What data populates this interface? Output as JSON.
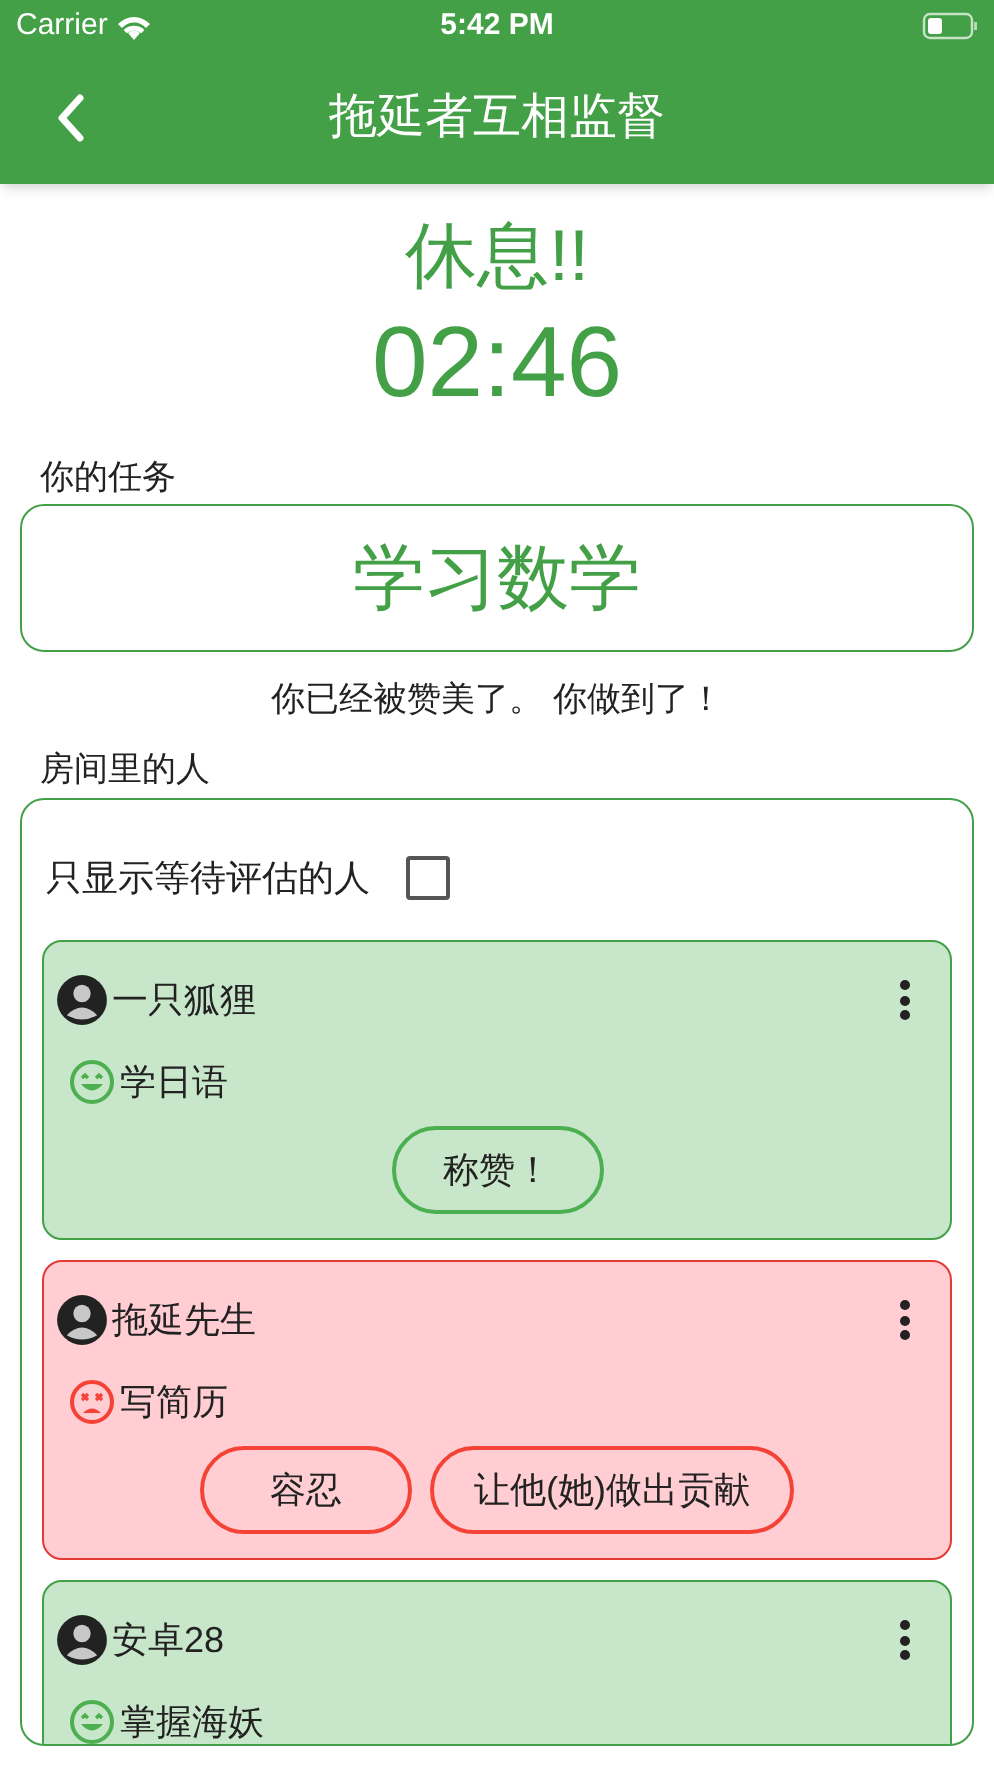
{
  "status_bar": {
    "carrier": "Carrier",
    "time": "5:42 PM"
  },
  "nav": {
    "title": "拖延者互相监督"
  },
  "state_title": "休息!!",
  "timer": "02:46",
  "task": {
    "label": "你的任务",
    "value": "学习数学"
  },
  "message": "你已经被赞美了。 你做到了！",
  "room": {
    "label": "房间里的人",
    "filter": {
      "label": "只显示等待评估的人",
      "checked": false
    },
    "people": [
      {
        "name": "一只狐狸",
        "task": "学日语",
        "kind": "good",
        "buttons": [
          "称赞！"
        ]
      },
      {
        "name": "拖延先生",
        "task": "写简历",
        "kind": "bad",
        "buttons": [
          "容忍",
          "让他(她)做出贡献"
        ]
      },
      {
        "name": "安卓28",
        "task": "掌握海妖",
        "kind": "good"
      }
    ]
  }
}
